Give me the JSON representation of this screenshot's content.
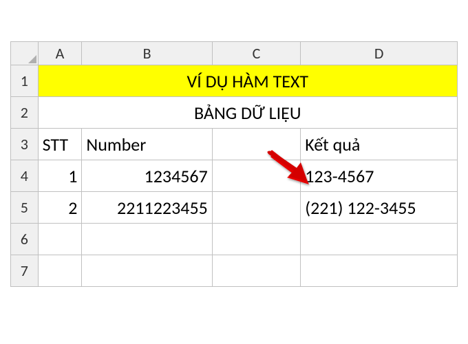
{
  "columns": {
    "A": "A",
    "B": "B",
    "C": "C",
    "D": "D"
  },
  "rows": {
    "r1": "1",
    "r2": "2",
    "r3": "3",
    "r4": "4",
    "r5": "5",
    "r6": "6",
    "r7": "7"
  },
  "title": "VÍ DỤ HÀM TEXT",
  "subtitle": "BẢNG DỮ LIỆU",
  "headers": {
    "stt": "STT",
    "number": "Number",
    "result": "Kết quả"
  },
  "data": {
    "row1": {
      "stt": "1",
      "number": "1234567",
      "result": "123-4567"
    },
    "row2": {
      "stt": "2",
      "number": "2211223455",
      "result": "(221) 122-3455"
    }
  },
  "colors": {
    "highlight": "#ffff00",
    "arrow": "#e60000"
  }
}
